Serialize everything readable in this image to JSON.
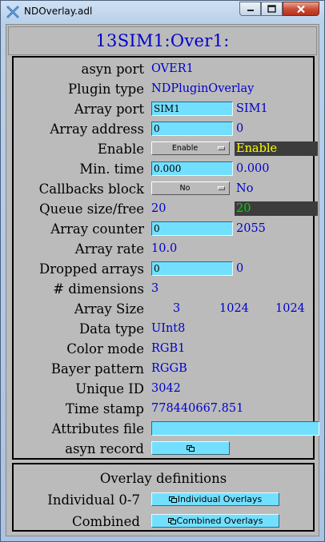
{
  "window": {
    "title": "NDOverlay.adl"
  },
  "header": {
    "title": "13SIM1:Over1:"
  },
  "rows": {
    "asyn_port": {
      "label": "asyn port",
      "value": "OVER1"
    },
    "plugin_type": {
      "label": "Plugin type",
      "value": "NDPluginOverlay"
    },
    "array_port": {
      "label": "Array port",
      "input": "SIM1",
      "readback": "SIM1"
    },
    "array_address": {
      "label": "Array address",
      "input": "0",
      "readback": "0"
    },
    "enable": {
      "label": "Enable",
      "menu": "Enable",
      "readback": "Enable"
    },
    "min_time": {
      "label": "Min. time",
      "input": "0.000",
      "readback": "0.000"
    },
    "callbacks_block": {
      "label": "Callbacks block",
      "menu": "No",
      "readback": "No"
    },
    "queue": {
      "label": "Queue size/free",
      "size": "20",
      "free": "20"
    },
    "array_counter": {
      "label": "Array counter",
      "input": "0",
      "readback": "2055"
    },
    "array_rate": {
      "label": "Array rate",
      "value": "10.0"
    },
    "dropped_arrays": {
      "label": "Dropped arrays",
      "input": "0",
      "readback": "0"
    },
    "dimensions": {
      "label": "# dimensions",
      "value": "3"
    },
    "array_size": {
      "label": "Array Size",
      "x": "3",
      "y": "1024",
      "z": "1024"
    },
    "data_type": {
      "label": "Data type",
      "value": "UInt8"
    },
    "color_mode": {
      "label": "Color mode",
      "value": "RGB1"
    },
    "bayer_pattern": {
      "label": "Bayer pattern",
      "value": "RGGB"
    },
    "unique_id": {
      "label": "Unique ID",
      "value": "3042"
    },
    "time_stamp": {
      "label": "Time stamp",
      "value": "778440667.851"
    },
    "attributes_file": {
      "label": "Attributes file",
      "input": ""
    },
    "asyn_record": {
      "label": "asyn record"
    }
  },
  "overlays": {
    "title": "Overlay definitions",
    "individual": {
      "label": "Individual 0-7",
      "button": "Individual Overlays"
    },
    "combined": {
      "label": "Combined",
      "button": "Combined Overlays"
    }
  },
  "colors": {
    "background": "#bbbbbb",
    "text_blue": "#0000cf",
    "input_cyan": "#73dfff",
    "alarm_bg": "#3c3c3c",
    "alarm_yellow": "#ffff00",
    "alarm_green": "#00d800"
  }
}
